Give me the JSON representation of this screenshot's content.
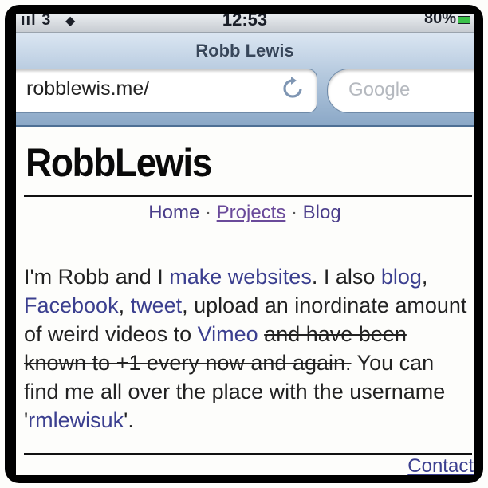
{
  "status_bar": {
    "signal": "ııl 3",
    "time": "12:53",
    "battery": "80%"
  },
  "browser": {
    "page_title": "Robb Lewis",
    "url": "robblewis.me/",
    "search_placeholder": "Google"
  },
  "site": {
    "title": "RobbLewis",
    "nav": [
      {
        "label": "Home"
      },
      {
        "label": "Projects"
      },
      {
        "label": "Blog"
      }
    ],
    "nav_separator": " · ",
    "bio": {
      "p1": "I'm Robb and I ",
      "link_websites": "make websites",
      "p2": ". I also ",
      "link_blog": "blog",
      "p3": ", ",
      "link_facebook": "Facebook",
      "p4": ", ",
      "link_tweet": "tweet",
      "p5": ", upload an inordinate amount of weird videos to ",
      "link_vimeo": "Vimeo",
      "p6": " ",
      "strikethrough": "and have been known to +1 every now and again.",
      "p7": " You can find me all over the place with the username '",
      "link_username": "rmlewisuk",
      "p8": "'."
    },
    "footer_link": "Contact"
  }
}
